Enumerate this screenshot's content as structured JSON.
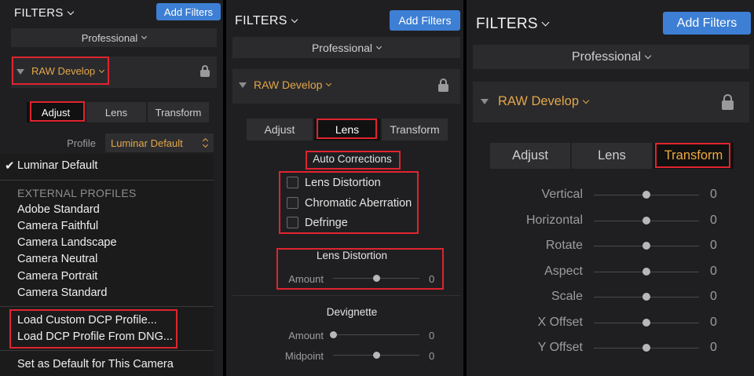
{
  "panel1": {
    "title": "FILTERS",
    "add_filters": "Add Filters",
    "preset": "Professional",
    "section": "RAW Develop",
    "tabs": [
      "Adjust",
      "Lens",
      "Transform"
    ],
    "profile_label": "Profile",
    "profile_value": "Luminar Default",
    "menu": {
      "selected": "Luminar Default",
      "external_header": "EXTERNAL PROFILES",
      "profiles": [
        "Adobe Standard",
        "Camera Faithful",
        "Camera Landscape",
        "Camera Neutral",
        "Camera Portrait",
        "Camera Standard"
      ],
      "load_custom": "Load Custom DCP Profile...",
      "load_dng": "Load DCP Profile From DNG...",
      "set_default": "Set as Default for This Camera"
    }
  },
  "panel2": {
    "title": "FILTERS",
    "add_filters": "Add Filters",
    "preset": "Professional",
    "section": "RAW Develop",
    "tabs": [
      "Adjust",
      "Lens",
      "Transform"
    ],
    "auto_corrections": "Auto Corrections",
    "checkboxes": [
      "Lens Distortion",
      "Chromatic Aberration",
      "Defringe"
    ],
    "lens_distortion": {
      "title": "Lens Distortion",
      "label": "Amount",
      "value": "0",
      "level": 0.5
    },
    "devignette": {
      "title": "Devignette",
      "sliders": [
        {
          "label": "Amount",
          "value": "0",
          "level": 0.0
        },
        {
          "label": "Midpoint",
          "value": "0",
          "level": 0.5
        }
      ]
    }
  },
  "panel3": {
    "title": "FILTERS",
    "add_filters": "Add Filters",
    "preset": "Professional",
    "section": "RAW Develop",
    "tabs": [
      "Adjust",
      "Lens",
      "Transform"
    ],
    "sliders": [
      {
        "label": "Vertical",
        "value": "0",
        "level": 0.5
      },
      {
        "label": "Horizontal",
        "value": "0",
        "level": 0.5
      },
      {
        "label": "Rotate",
        "value": "0",
        "level": 0.5
      },
      {
        "label": "Aspect",
        "value": "0",
        "level": 0.5
      },
      {
        "label": "Scale",
        "value": "0",
        "level": 0.5
      },
      {
        "label": "X Offset",
        "value": "0",
        "level": 0.5
      },
      {
        "label": "Y Offset",
        "value": "0",
        "level": 0.5
      }
    ]
  },
  "colors": {
    "accent_blue": "#3d7fd4",
    "raw_orange": "#e3a64a",
    "highlight_red": "#e0242f"
  },
  "icons": [
    "chevron-down-icon",
    "collapse-triangle-icon",
    "lock-icon",
    "updown-chevron-icon",
    "checkmark-icon"
  ]
}
